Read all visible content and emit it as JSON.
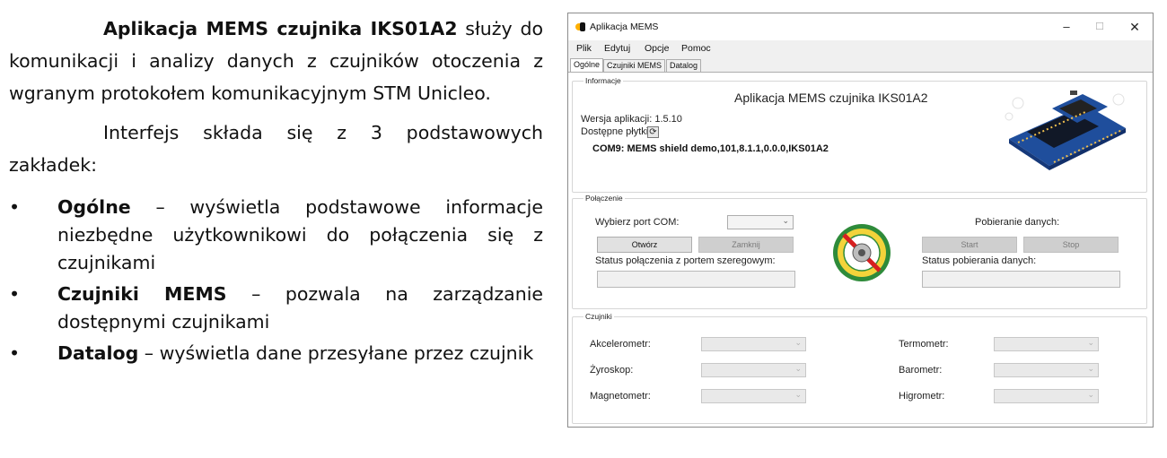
{
  "document": {
    "para1": {
      "bold": "Aplikacja MEMS czujnika IKS01A2",
      "rest": " służy do komunikacji i analizy danych z czujników otoczenia z wgranym protokołem komunikacyjnym STM Unicleo."
    },
    "para2": "Interfejs składa się z 3 podstawowych zakładek:",
    "bullets": [
      {
        "bold": "Ogólne",
        "rest": " – wyświetla podstawowe informacje niezbędne użytkownikowi do połączenia się z czujnikami"
      },
      {
        "bold": "Czujniki MEMS",
        "rest": " – pozwala na zarządzanie dostępnymi czujnikami"
      },
      {
        "bold": "Datalog",
        "rest": " – wyświetla dane przesyłane przez czujnik"
      }
    ],
    "bullet_symbol": "•"
  },
  "window": {
    "title": "Aplikacja MEMS",
    "controls": {
      "minimize": "–",
      "maximize": "☐",
      "close": "✕"
    },
    "menu": [
      "Plik",
      "Edytuj",
      "Opcje",
      "Pomoc"
    ],
    "tabs": [
      "Ogólne",
      "Czujniki MEMS",
      "Datalog"
    ],
    "active_tab": "Ogólne",
    "info": {
      "group_label": "Informacje",
      "heading": "Aplikacja MEMS czujnika IKS01A2",
      "version": "Wersja aplikacji: 1.5.10",
      "boards_label": "Dostępne płytki:",
      "board_entry": "COM9: MEMS shield demo,101,8.1.1,0.0.0,IKS01A2"
    },
    "connection": {
      "group_label": "Połączenie",
      "port_label": "Wybierz port COM:",
      "port_value": "",
      "open_button": "Otwórz",
      "close_button": "Zamknij",
      "conn_status_label": "Status połączenia z portem szeregowym:",
      "conn_status_value": "",
      "datalog_label": "Pobieranie danych:",
      "start_button": "Start",
      "stop_button": "Stop",
      "datalog_status_label": "Status pobierania danych:",
      "datalog_status_value": ""
    },
    "sensors": {
      "group_label": "Czujniki",
      "left": [
        "Akcelerometr:",
        "Żyroskop:",
        "Magnetometr:"
      ],
      "right": [
        "Termometr:",
        "Barometr:",
        "Higrometr:"
      ]
    }
  },
  "colors": {
    "window_bg": "#f0f0f0",
    "tab_page_bg": "#ffffff",
    "disabled_text": "#7a7a7a",
    "board_blue": "#1f4e9c",
    "logo_green": "#2e8b3a",
    "logo_red": "#d62020"
  }
}
